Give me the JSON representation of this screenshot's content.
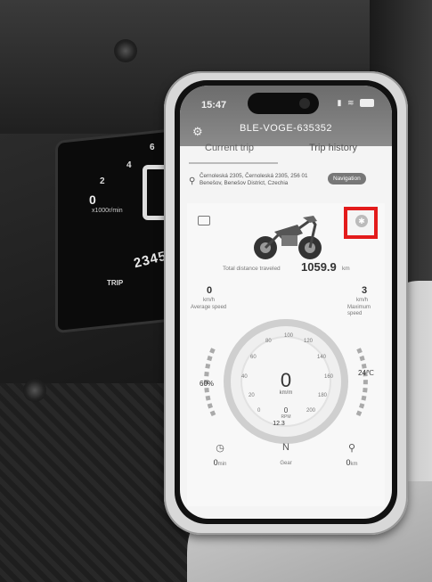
{
  "moto_dash": {
    "zero": "0",
    "km_unit": "x1000r/min",
    "tick_2": "2",
    "tick_4": "4",
    "tick_6": "6",
    "trip_label": "TRIP",
    "odometer": "2345"
  },
  "phone": {
    "status_time": "15:47",
    "battery": "8",
    "device_name": "BLE-VOGE-635352",
    "tabs": {
      "current": "Current trip",
      "history": "Trip history"
    },
    "address": "Černoleská 2305, Černoleská 2305, 256 01 Benešov, Benešov District, Czechia",
    "navigation_label": "Navigation",
    "distance_label": "Total distance traveled",
    "distance_value": "1059.9",
    "distance_unit": "km",
    "left_speed_value": "0",
    "left_speed_unit": "km/h",
    "left_speed_label": "Average speed",
    "right_speed_value": "3",
    "right_speed_unit": "km/h",
    "right_speed_label": "Maximum speed",
    "gauge_ticks": [
      "0",
      "20",
      "40",
      "60",
      "80",
      "100",
      "120",
      "140",
      "160",
      "180",
      "200"
    ],
    "speed": "0",
    "speed_unit": "km/m",
    "rpm_value": "0",
    "rpm_label": "RPM",
    "battery_percent": "60%",
    "temperature": "24℃",
    "fuel_value": "12.3",
    "stats": [
      {
        "icon": "clock-icon",
        "value": "0",
        "unit": "min"
      },
      {
        "icon": "gear-letter",
        "value": "N",
        "unit": "Gear"
      },
      {
        "icon": "distance-icon",
        "value": "0",
        "unit": "km"
      }
    ]
  },
  "colors": {
    "highlight": "#e31b1b",
    "header": "#7a7a7a"
  }
}
